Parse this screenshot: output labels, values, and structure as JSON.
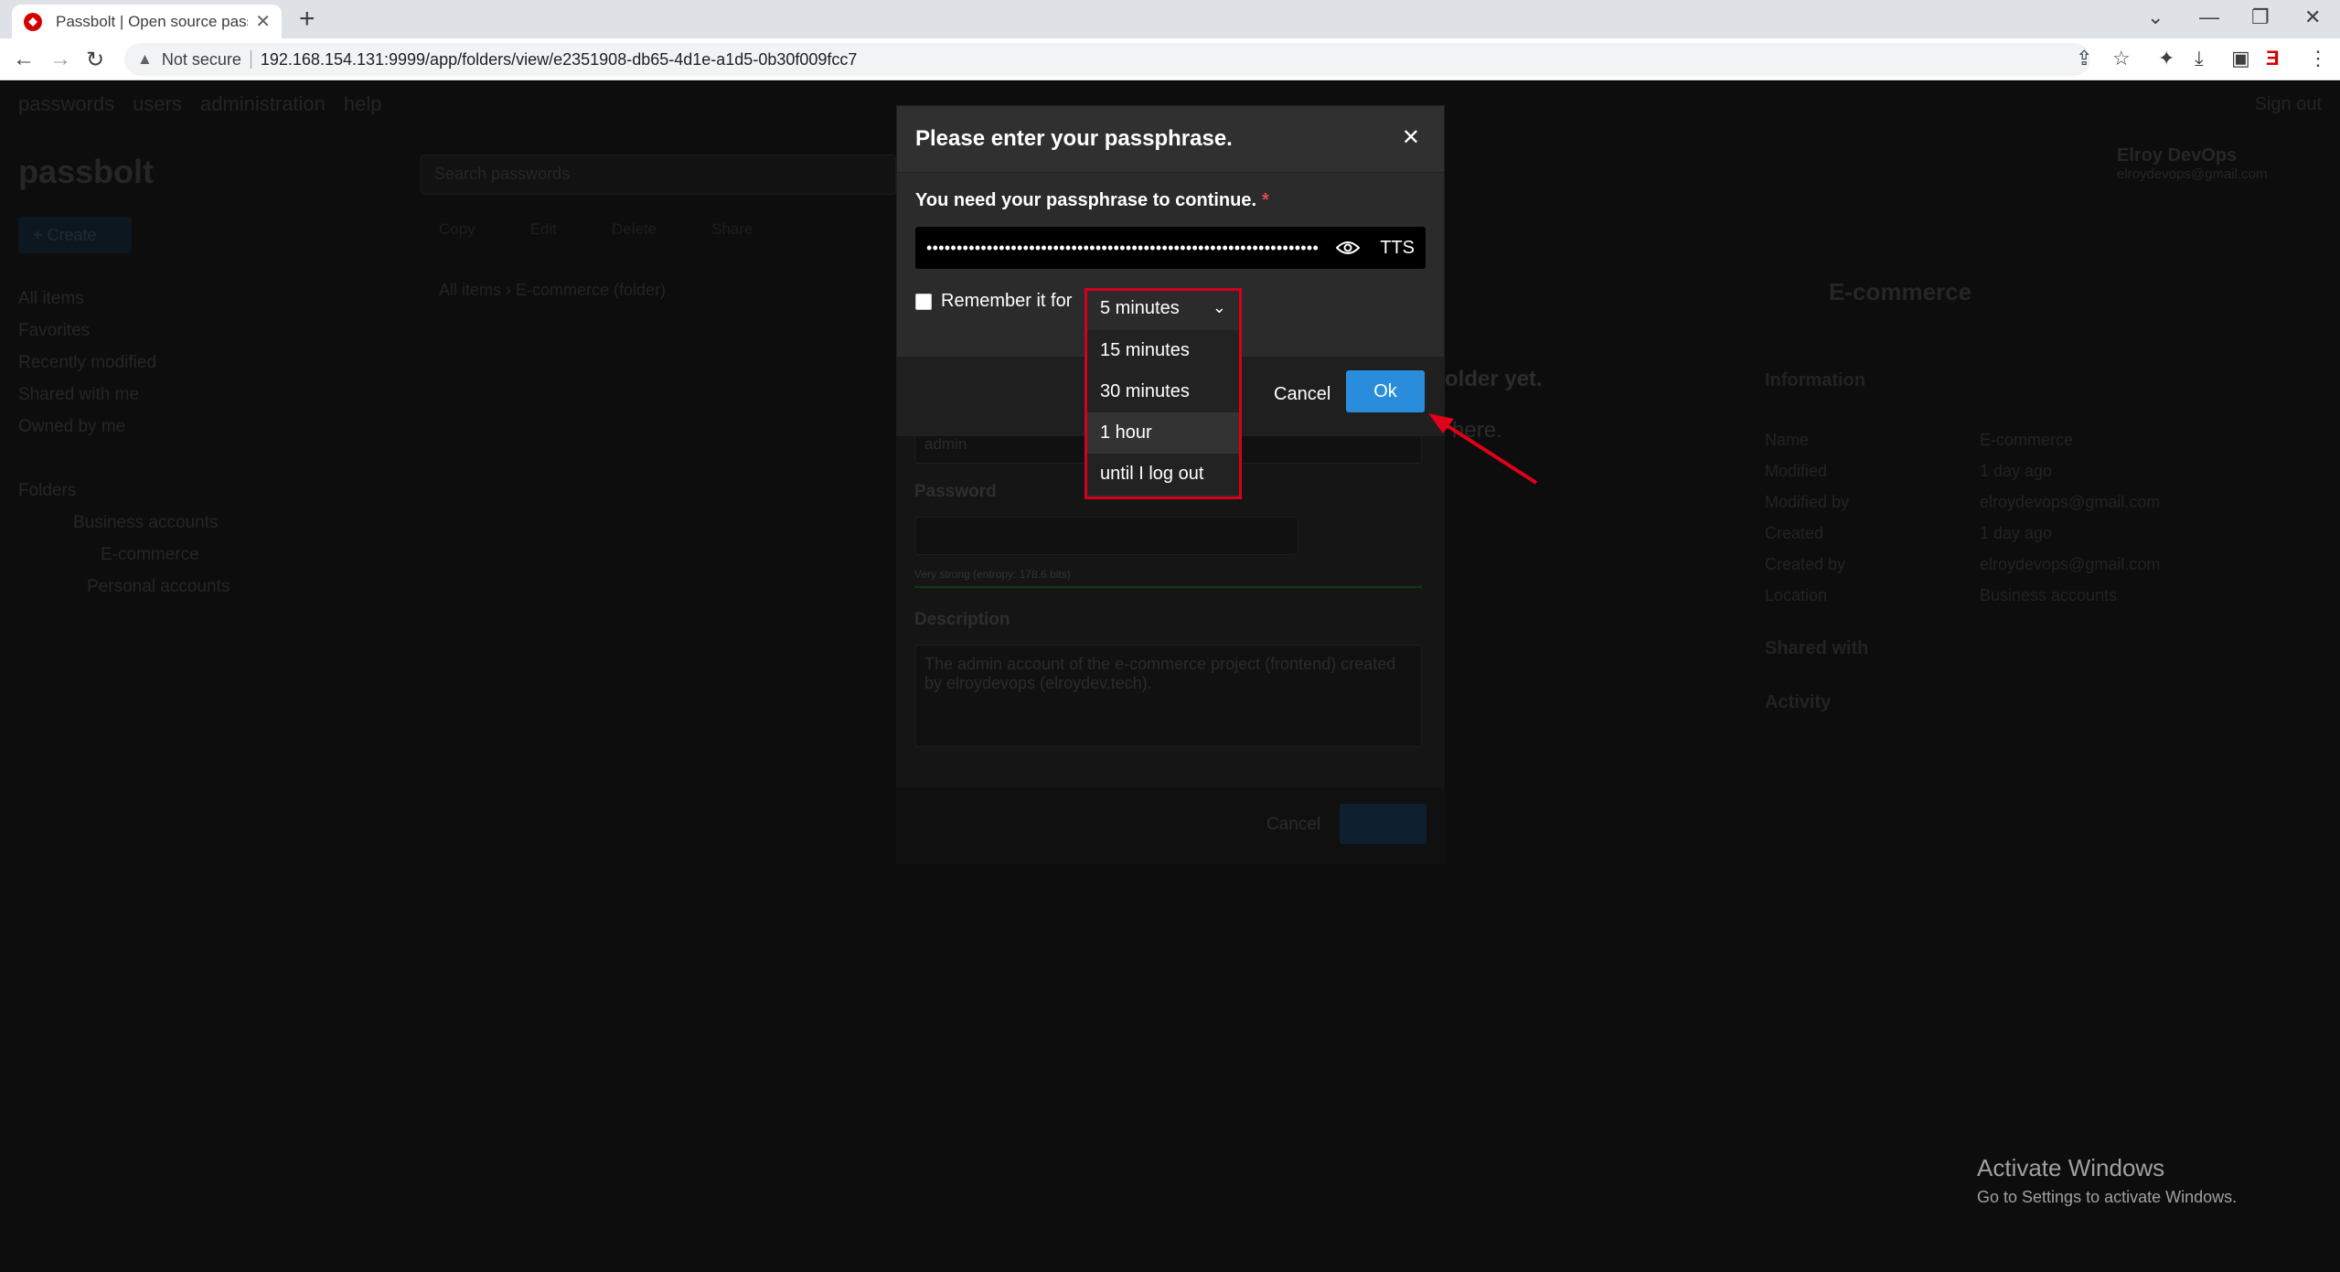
{
  "browser": {
    "tab_title": "Passbolt | Open source passwor",
    "url_security": "Not secure",
    "url": "192.168.154.131:9999/app/folders/view/e2351908-db65-4d1e-a1d5-0b30f009fcc7"
  },
  "app_background": {
    "nav": [
      "passwords",
      "users",
      "administration",
      "help"
    ],
    "sign_out": "Sign out",
    "logo": "passbolt",
    "search_placeholder": "Search passwords",
    "create_label": "+ Create",
    "left_nav": [
      "All items",
      "Favorites",
      "Recently modified",
      "Shared with me",
      "Owned by me"
    ],
    "folders_title": "Folders",
    "folders": [
      "Business accounts",
      "E-commerce",
      "Personal accounts"
    ],
    "actions": [
      "Copy",
      "Edit",
      "Delete",
      "Share"
    ],
    "breadcrumb": "All items › E-commerce (folder)",
    "user_name": "Elroy DevOps",
    "user_email": "elroydevops@gmail.com",
    "panel_title": "E-commerce",
    "panel_sections": [
      "Information",
      "Shared with",
      "Activity"
    ],
    "info_rows": [
      {
        "k": "Name",
        "v": "E-commerce"
      },
      {
        "k": "Modified",
        "v": "1 day ago"
      },
      {
        "k": "Modified by",
        "v": "elroydevops@gmail.com"
      },
      {
        "k": "Created",
        "v": "1 day ago"
      },
      {
        "k": "Created by",
        "v": "elroydevops@gmail.com"
      },
      {
        "k": "Location",
        "v": "Business accounts"
      }
    ],
    "empty_msg": "older yet.",
    "empty_msg2": "here.",
    "edit_username": "admin",
    "edit_password_label": "Password",
    "edit_strength": "Very strong (entropy: 178.6 bits)",
    "edit_description_label": "Description",
    "edit_description": "The admin account of the e-commerce project (frontend) created by elroydevops (elroydev.tech).",
    "edit_cancel": "Cancel"
  },
  "modal": {
    "title": "Please enter your passphrase.",
    "label": "You need your passphrase to continue.",
    "required_mark": "*",
    "passphrase_masked": "•••••••••••••••••••••••••••••••••••••••••••••••••••••••••••••••••",
    "tts_label": "TTS",
    "remember_label": "Remember it for",
    "remember_checked": false,
    "cancel_label": "Cancel",
    "ok_label": "Ok",
    "ok_color": "#2a8ddb"
  },
  "dropdown": {
    "selected": "5 minutes",
    "options": [
      "15 minutes",
      "30 minutes",
      "1 hour",
      "until I log out"
    ],
    "hovered": "1 hour",
    "highlight_color": "#d6001c"
  },
  "os_watermark": {
    "line1": "Activate Windows",
    "line2": "Go to Settings to activate Windows."
  }
}
